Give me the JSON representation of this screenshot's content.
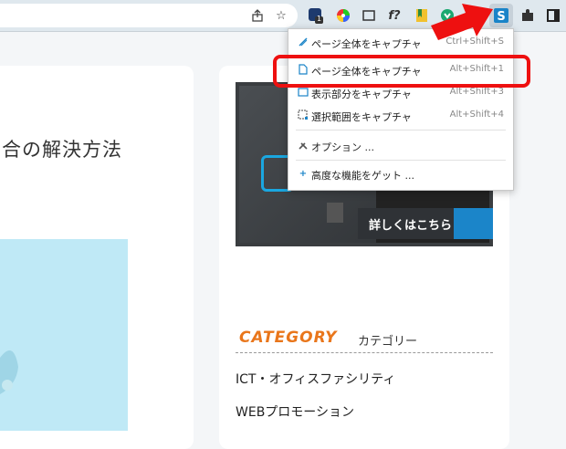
{
  "toolbar": {
    "icons": [
      "share-icon",
      "star-icon",
      "extension-badge-icon",
      "color-wheel-icon",
      "screenshot-frame-icon",
      "formula-icon",
      "folder-icon",
      "vpn-icon",
      "capture-extension-icon",
      "puzzle-icon",
      "sidepanel-icon"
    ],
    "badge_count": "1",
    "formula_glyph": "f?"
  },
  "page": {
    "heading": "合の解決方法",
    "banner_cta": "詳しくはこちら",
    "banner_arrow": "→",
    "category_title": "CATEGORY",
    "category_sub": "カテゴリー",
    "category_links": [
      "ICT・オフィスファシリティ",
      "WEBプロモーション"
    ]
  },
  "menu": {
    "items": [
      {
        "icon": "pen-icon",
        "label": "ページ全体をキャプチャ",
        "shortcut": "Ctrl+Shift+S"
      },
      {
        "icon": "page-icon",
        "label": "ページ全体をキャプチャ",
        "shortcut": "Alt+Shift+1"
      },
      {
        "icon": "visible-icon",
        "label": "表示部分をキャプチャ",
        "shortcut": "Alt+Shift+3"
      },
      {
        "icon": "region-icon",
        "label": "選択範囲をキャプチャ",
        "shortcut": "Alt+Shift+4"
      },
      {
        "icon": "tools-icon",
        "label": "オプション ...",
        "shortcut": ""
      },
      {
        "icon": "plus-icon",
        "label": "高度な機能をゲット ...",
        "shortcut": ""
      }
    ]
  },
  "colors": {
    "highlight": "#ee1010",
    "accent": "#1b85c9",
    "category": "#e9761b"
  }
}
